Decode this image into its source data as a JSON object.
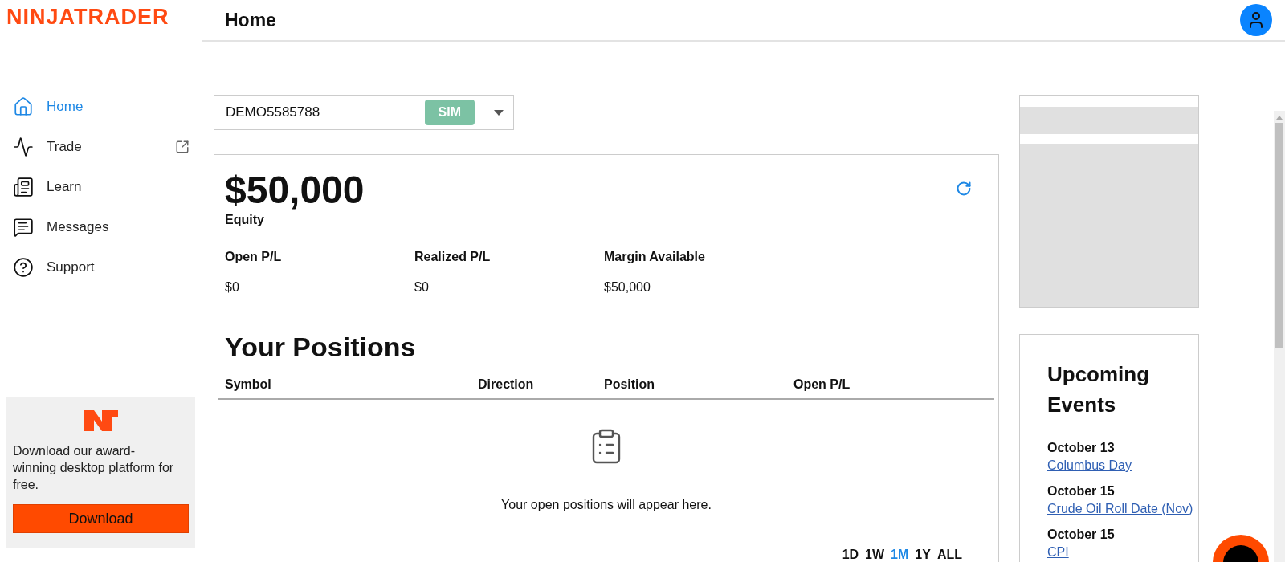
{
  "logo": "NINJATRADER",
  "page_title": "Home",
  "nav": [
    {
      "label": "Home",
      "selected": true,
      "external": false
    },
    {
      "label": "Trade",
      "selected": false,
      "external": true
    },
    {
      "label": "Learn",
      "selected": false,
      "external": false
    },
    {
      "label": "Messages",
      "selected": false,
      "external": false
    },
    {
      "label": "Support",
      "selected": false,
      "external": false
    }
  ],
  "promo": {
    "text": "Download our award-winning desktop platform for free.",
    "button": "Download"
  },
  "account": {
    "id": "DEMO5585788",
    "badge": "SIM"
  },
  "equity": {
    "value": "$50,000",
    "label": "Equity"
  },
  "metrics": [
    {
      "label": "Open P/L",
      "value": "$0"
    },
    {
      "label": "Realized P/L",
      "value": "$0"
    },
    {
      "label": "Margin Available",
      "value": "$50,000"
    }
  ],
  "positions": {
    "title": "Your Positions",
    "columns": [
      "Symbol",
      "Direction",
      "Position",
      "Open P/L"
    ],
    "empty_text": "Your open positions will appear here."
  },
  "range_buttons": [
    {
      "label": "1D",
      "selected": false
    },
    {
      "label": "1W",
      "selected": false
    },
    {
      "label": "1M",
      "selected": true
    },
    {
      "label": "1Y",
      "selected": false
    },
    {
      "label": "ALL",
      "selected": false
    }
  ],
  "events": {
    "title": "Upcoming Events",
    "items": [
      {
        "date": "October 13",
        "link": "Columbus Day"
      },
      {
        "date": "October 15",
        "link": "Crude Oil Roll Date (Nov)"
      },
      {
        "date": "October 15",
        "link": "CPI"
      }
    ]
  }
}
